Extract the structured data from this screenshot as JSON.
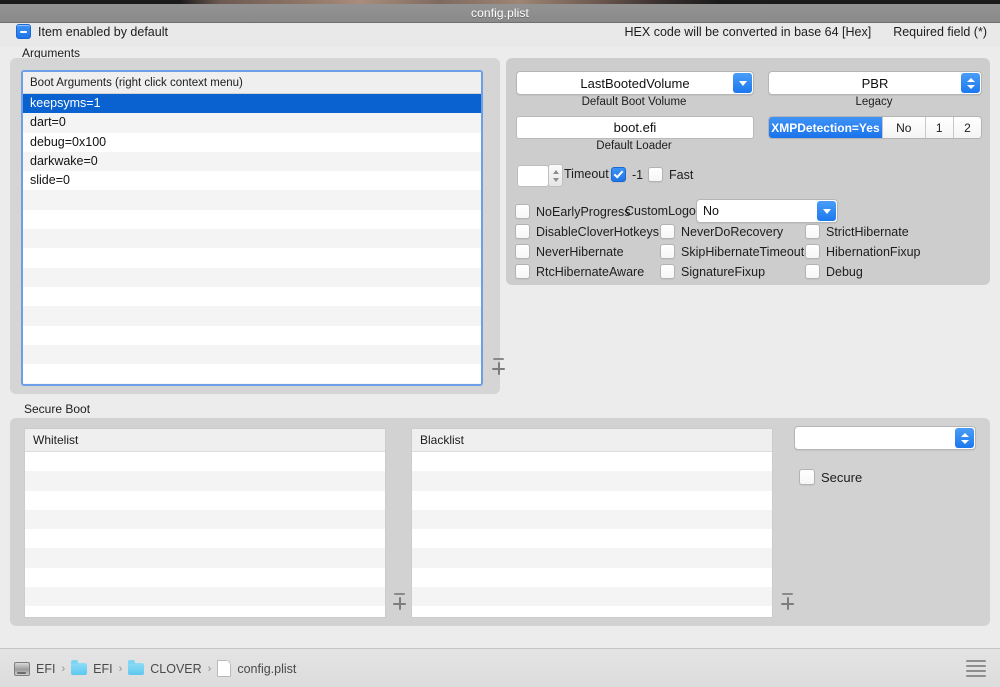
{
  "window": {
    "title": "config.plist"
  },
  "topbar": {
    "enabled_label": "Item enabled by default",
    "hex_hint": "HEX code will be converted in base 64 [Hex]",
    "required_hint": "Required field (*)"
  },
  "arguments": {
    "group_label": "Arguments",
    "list_header": "Boot Arguments (right click context menu)",
    "items": [
      {
        "text": "keepsyms=1",
        "selected": true
      },
      {
        "text": "dart=0",
        "selected": false
      },
      {
        "text": "debug=0x100",
        "selected": false
      },
      {
        "text": "darkwake=0",
        "selected": false
      },
      {
        "text": "slide=0",
        "selected": false
      }
    ],
    "empty_rows": 11,
    "remove_label": "-",
    "add_label": "+"
  },
  "options": {
    "default_boot_volume": {
      "value": "LastBootedVolume",
      "label": "Default Boot Volume"
    },
    "default_loader": {
      "value": "boot.efi",
      "label": "Default Loader"
    },
    "legacy": {
      "value": "PBR",
      "label": "Legacy"
    },
    "xmp_segments": [
      {
        "label": "XMPDetection=Yes",
        "active": true
      },
      {
        "label": "No",
        "active": false
      },
      {
        "label": "1",
        "active": false
      },
      {
        "label": "2",
        "active": false
      }
    ],
    "timeout": {
      "value": "",
      "label": "Timeout"
    },
    "minus_one": {
      "label": "-1",
      "checked": true
    },
    "fast": {
      "label": "Fast",
      "checked": false
    },
    "custom_logo": {
      "label": "CustomLogo",
      "value": "No"
    },
    "checkboxes": [
      {
        "label": "NoEarlyProgress",
        "checked": false
      },
      {
        "label": "DisableCloverHotkeys",
        "checked": false
      },
      {
        "label": "NeverHibernate",
        "checked": false
      },
      {
        "label": "RtcHibernateAware",
        "checked": false
      },
      {
        "label": "NeverDoRecovery",
        "checked": false
      },
      {
        "label": "SkipHibernateTimeout",
        "checked": false
      },
      {
        "label": "SignatureFixup",
        "checked": false
      },
      {
        "label": "StrictHibernate",
        "checked": false
      },
      {
        "label": "HibernationFixup",
        "checked": false
      },
      {
        "label": "Debug",
        "checked": false
      }
    ]
  },
  "secure_boot": {
    "group_label": "Secure Boot",
    "whitelist": {
      "header": "Whitelist",
      "items": [],
      "empty_rows": 9
    },
    "blacklist": {
      "header": "Blacklist",
      "items": [],
      "empty_rows": 9
    },
    "policy": {
      "value": ""
    },
    "secure": {
      "label": "Secure",
      "checked": false
    },
    "remove_label": "-",
    "add_label": "+"
  },
  "breadcrumb": {
    "items": [
      {
        "label": "EFI",
        "icon": "drive-icon"
      },
      {
        "label": "EFI",
        "icon": "folder-icon"
      },
      {
        "label": "CLOVER",
        "icon": "folder-icon"
      },
      {
        "label": "config.plist",
        "icon": "document-icon"
      }
    ],
    "separator": "›"
  },
  "colors": {
    "accent": "#1f74e8",
    "selection": "#0a62d0",
    "window_bg": "#ececec",
    "panel_bg": "#d2d2d2",
    "titlebar": "#8a8a8a"
  }
}
